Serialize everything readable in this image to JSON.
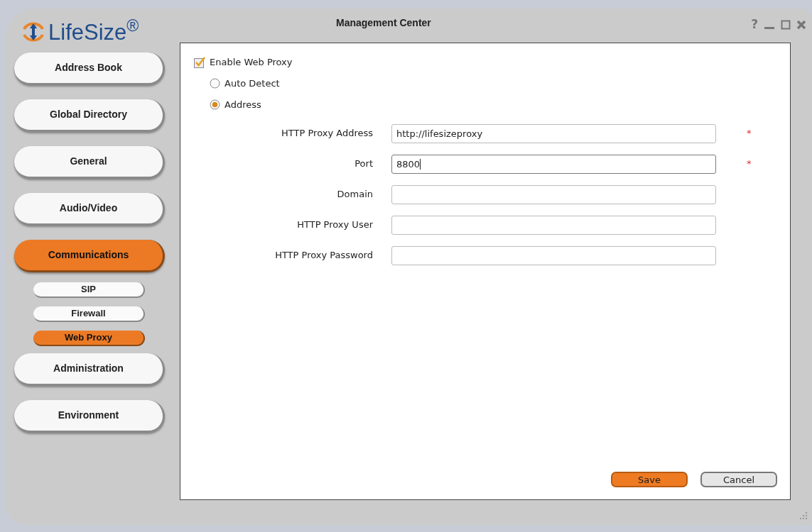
{
  "window": {
    "title": "Management Center",
    "controls": [
      "?"
    ]
  },
  "logo": {
    "text": "LifeSize$^{®}$"
  },
  "sidebar": {
    "items": [
      {
        "label": "Address Book",
        "selected": false
      },
      {
        "label": "Global Directory",
        "selected": false
      },
      {
        "label": "General",
        "selected": false
      },
      {
        "label": "Audio/Video",
        "selected": false
      },
      {
        "label": "Communications",
        "selected": true,
        "children": [
          {
            "label": "SIP",
            "selected": false
          },
          {
            "label": "Firewall",
            "selected": false
          },
          {
            "label": "Web Proxy",
            "selected": true
          }
        ]
      },
      {
        "label": "Administration",
        "selected": false
      },
      {
        "label": "Environment",
        "selected": false
      }
    ]
  },
  "enable": {
    "label": "Enable Web Proxy",
    "checked": true
  },
  "mode": [
    {
      "label": "Auto Detect",
      "selected": false
    },
    {
      "label": "Address",
      "selected": true
    }
  ],
  "fields": [
    {
      "label": "HTTP Proxy Address",
      "value": "http://lifesizeproxy",
      "required_mark": "*",
      "focused": false
    },
    {
      "label": "Port",
      "value": "8800",
      "required_mark": "*",
      "focused": true
    },
    {
      "label": "Domain",
      "focused": false
    },
    {
      "label": "HTTP Proxy User",
      "focused": false
    },
    {
      "label": "HTTP Proxy Password",
      "focused": false
    }
  ],
  "buttons": [
    {
      "label": "Save",
      "kind": "primary"
    },
    {
      "label": "Cancel",
      "kind": "secondary"
    }
  ]
}
